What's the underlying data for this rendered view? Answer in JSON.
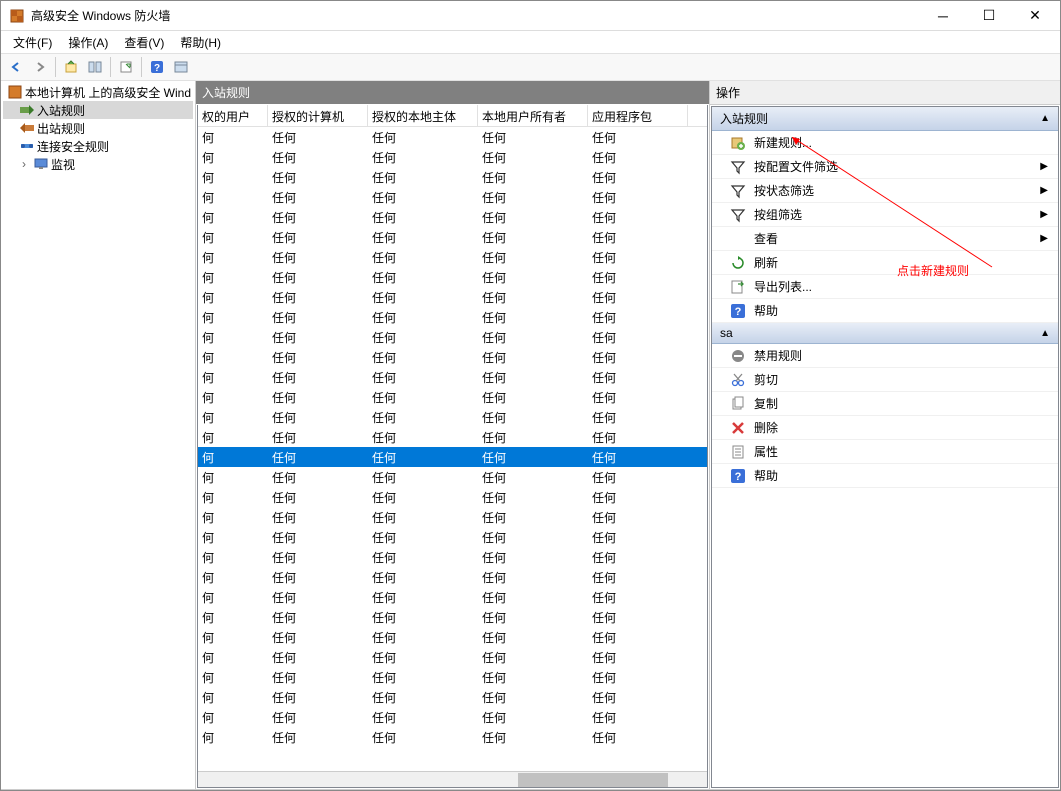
{
  "window": {
    "title": "高级安全 Windows 防火墙"
  },
  "menus": [
    "文件(F)",
    "操作(A)",
    "查看(V)",
    "帮助(H)"
  ],
  "tree": {
    "root": "本地计算机 上的高级安全 Wind",
    "items": [
      "入站规则",
      "出站规则",
      "连接安全规则",
      "监视"
    ]
  },
  "center": {
    "header": "入站规则",
    "columns": [
      "权的用户",
      "授权的计算机",
      "授权的本地主体",
      "本地用户所有者",
      "应用程序包"
    ],
    "cell_value": "何",
    "cell_value2": "任何",
    "row_count": 31,
    "selected_index": 16
  },
  "actions": {
    "header": "操作",
    "section1": "入站规则",
    "items1": [
      {
        "label": "新建规则...",
        "icon": "new-rule",
        "sub": false
      },
      {
        "label": "按配置文件筛选",
        "icon": "filter",
        "sub": true
      },
      {
        "label": "按状态筛选",
        "icon": "filter",
        "sub": true
      },
      {
        "label": "按组筛选",
        "icon": "filter",
        "sub": true
      },
      {
        "label": "查看",
        "icon": "",
        "sub": true
      },
      {
        "label": "刷新",
        "icon": "refresh",
        "sub": false
      },
      {
        "label": "导出列表...",
        "icon": "export",
        "sub": false
      },
      {
        "label": "帮助",
        "icon": "help",
        "sub": false
      }
    ],
    "section2": "sa",
    "items2": [
      {
        "label": "禁用规则",
        "icon": "disable"
      },
      {
        "label": "剪切",
        "icon": "cut"
      },
      {
        "label": "复制",
        "icon": "copy"
      },
      {
        "label": "删除",
        "icon": "delete"
      },
      {
        "label": "属性",
        "icon": "props"
      },
      {
        "label": "帮助",
        "icon": "help"
      }
    ]
  },
  "annotation": "点击新建规则"
}
